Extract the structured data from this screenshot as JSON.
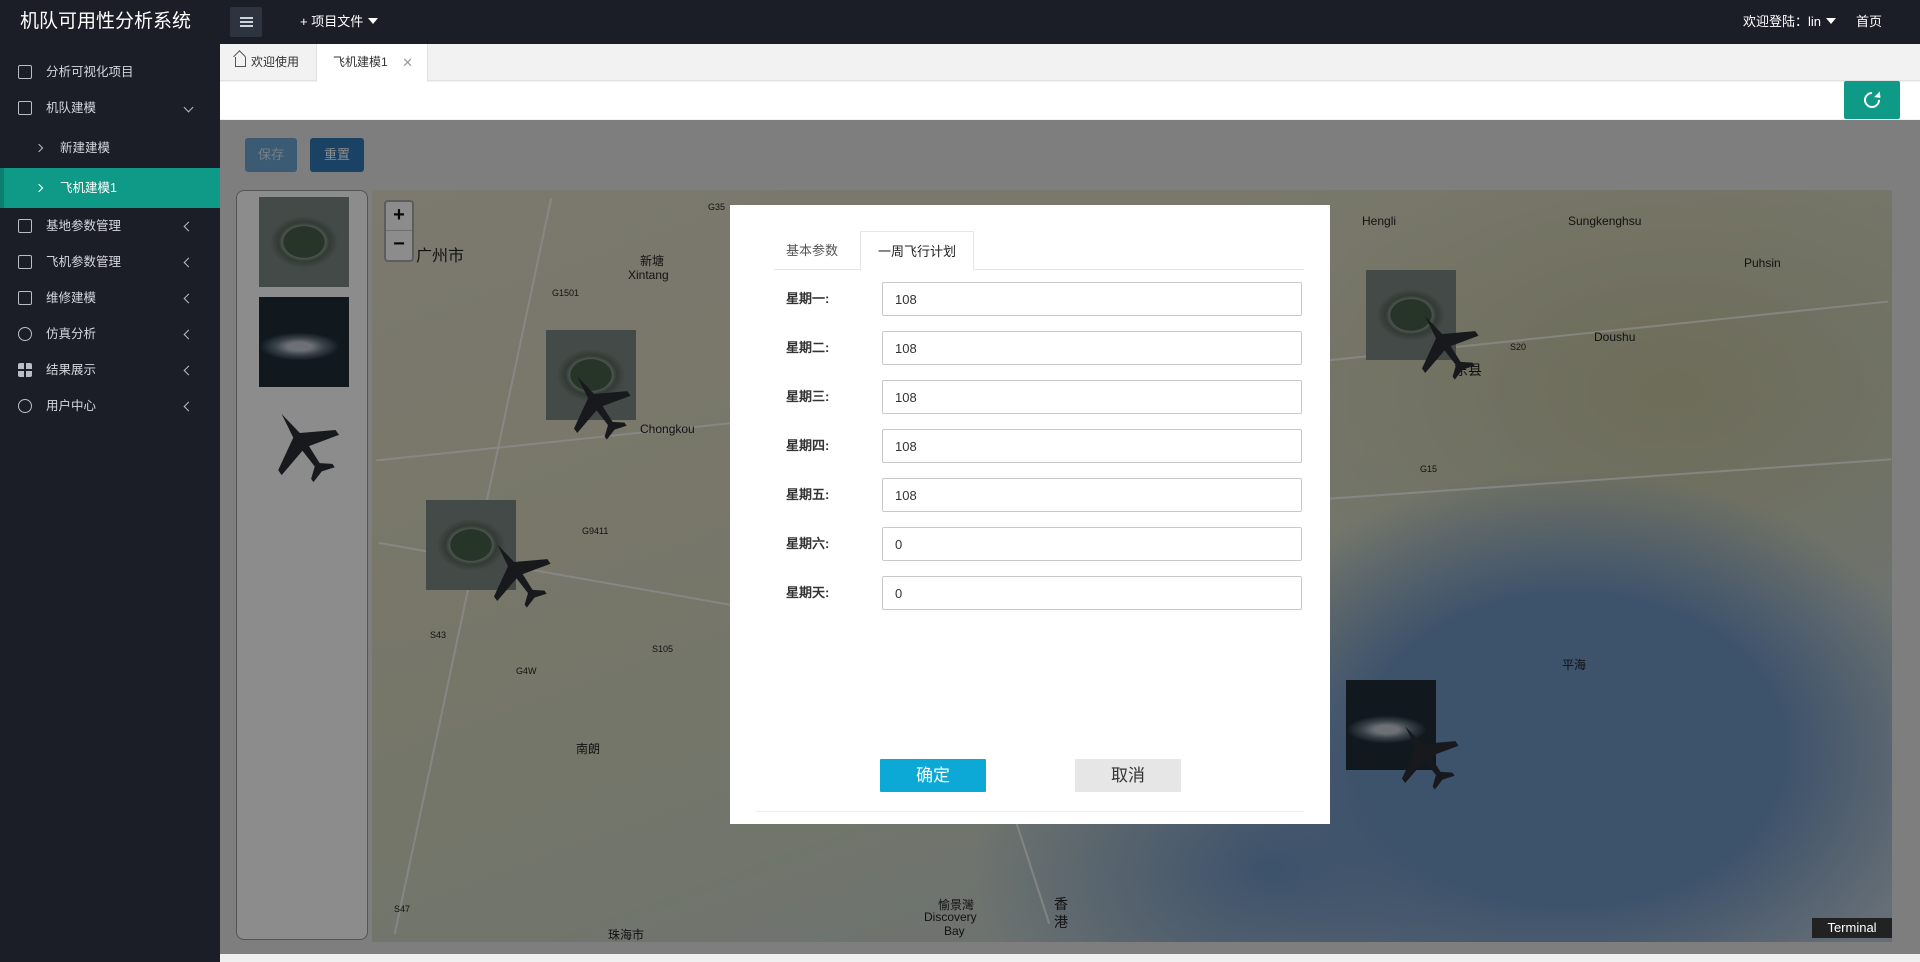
{
  "app": {
    "title": "机队可用性分析系统"
  },
  "topbar": {
    "project_menu": "+ 项目文件",
    "welcome": "欢迎登陆：lin",
    "home": "首页"
  },
  "sidebar": {
    "items": [
      {
        "label": "分析可视化项目",
        "icon": "dashboard-icon"
      },
      {
        "label": "机队建模",
        "icon": "cube-icon",
        "expanded": true
      },
      {
        "label": "新建建模",
        "sub": true
      },
      {
        "label": "飞机建模1",
        "sub": true,
        "active": true
      },
      {
        "label": "基地参数管理",
        "icon": "document-icon"
      },
      {
        "label": "飞机参数管理",
        "icon": "document-icon"
      },
      {
        "label": "维修建模",
        "icon": "document-icon"
      },
      {
        "label": "仿真分析",
        "icon": "gear-icon"
      },
      {
        "label": "结果展示",
        "icon": "grid-icon"
      },
      {
        "label": "用户中心",
        "icon": "user-icon"
      }
    ]
  },
  "tabs": {
    "welcome": "欢迎使用",
    "model": "飞机建模1",
    "close_glyph": "✕"
  },
  "toolbar": {
    "save": "保存",
    "reset": "重置"
  },
  "map": {
    "zoom_in": "+",
    "zoom_out": "−",
    "labels": {
      "guangzhou": "广州市",
      "xintang_cn": "新塘",
      "xintang": "Xintang",
      "chongkou": "Chongkou",
      "hengli": "Hengli",
      "sungkenghsu": "Sungkenghsu",
      "puhsin": "Puhsin",
      "doushu": "Doushu",
      "dongxian": "东县",
      "pinghai": "平海",
      "nanlang": "南朗",
      "zhuhai": "珠海市",
      "discovery1": "愉景灣",
      "discovery2": "Discovery",
      "discovery3": "Bay",
      "hk1": "香",
      "hk2": "港",
      "g1501": "G1501",
      "g9411": "G9411",
      "s43": "S43",
      "s105": "S105",
      "g4w": "G4W",
      "g15": "G15",
      "s20": "S20",
      "s47": "S47",
      "g35": "G35"
    }
  },
  "terminal": "Terminal",
  "modal": {
    "tab_basic": "基本参数",
    "tab_weekly": "一周飞行计划",
    "fields": [
      {
        "label": "星期一:",
        "value": "108"
      },
      {
        "label": "星期二:",
        "value": "108"
      },
      {
        "label": "星期三:",
        "value": "108"
      },
      {
        "label": "星期四:",
        "value": "108"
      },
      {
        "label": "星期五:",
        "value": "108"
      },
      {
        "label": "星期六:",
        "value": "0"
      },
      {
        "label": "星期天:",
        "value": "0"
      }
    ],
    "ok": "确定",
    "cancel": "取消"
  },
  "colors": {
    "sidebar_bg": "#1b1e26",
    "accent": "#0f9a87",
    "ok_button": "#0ca9d6",
    "reset_button": "#2e78b8"
  }
}
